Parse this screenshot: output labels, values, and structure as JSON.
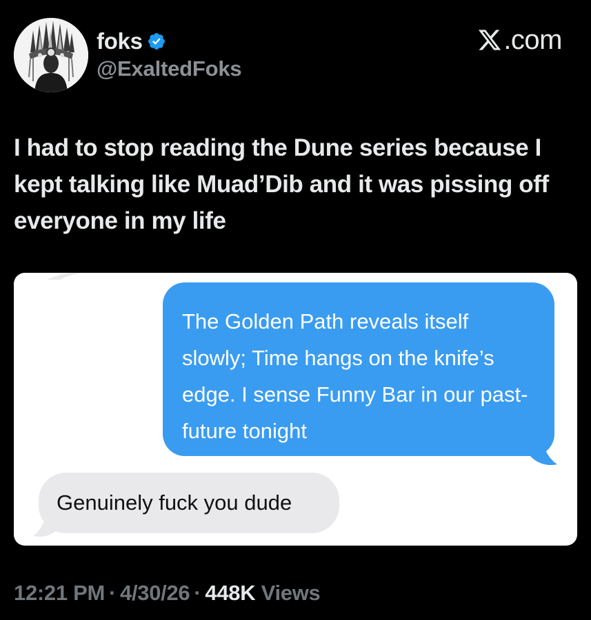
{
  "author": {
    "display_name": "foks",
    "handle": "@ExaltedFoks",
    "verified": true,
    "verified_color": "#1d9bf0",
    "avatar_icon": "ornate-crown-avatar-icon"
  },
  "brand": {
    "label": ".com",
    "icon": "x-logo-icon"
  },
  "tweet": {
    "text": "I had to stop reading the Dune series because I kept talking like Muad’Dib and it was pissing off everyone in my life"
  },
  "media": {
    "outgoing_message": "The Golden Path reveals itself slowly; Time hangs on the knife’s edge. I sense Funny Bar in our past-future tonight",
    "incoming_message": "Genuinely fuck you dude",
    "outgoing_color": "#3a9cf0",
    "incoming_color": "#e9e9eb"
  },
  "meta": {
    "time": "12:21 PM",
    "date": "4/30/26",
    "separator": "·",
    "views_count": "448K",
    "views_label": " Views"
  }
}
